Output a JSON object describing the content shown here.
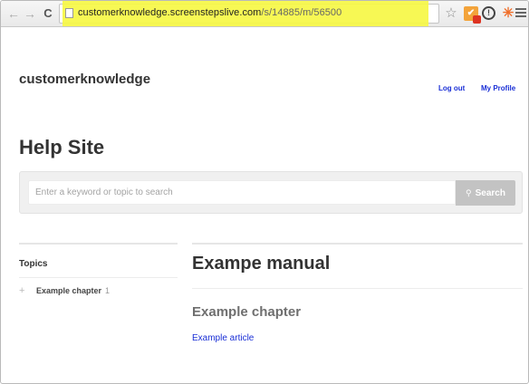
{
  "browser": {
    "url_host": "customerknowledge.screenstepslive.com",
    "url_path": "/s/14885/m/56500",
    "icons": [
      "back-arrow-icon",
      "forward-arrow-icon",
      "reload-icon",
      "page-icon",
      "star-icon",
      "extension-orange-icon",
      "extension-circle-icon",
      "hubspot-icon",
      "menu-icon"
    ],
    "highlight_color": "#f6f745"
  },
  "header": {
    "brand": "customerknowledge",
    "logout_label": "Log out",
    "profile_label": "My Profile",
    "link_color": "#1a2fd6"
  },
  "site": {
    "title": "Help Site"
  },
  "search": {
    "placeholder": "Enter a keyword or topic to search",
    "value": "",
    "button_label": "Search",
    "button_icon": "search-icon"
  },
  "sidebar": {
    "title": "Topics",
    "items": [
      {
        "label": "Example chapter",
        "count": "1",
        "icon": "plus-icon"
      }
    ]
  },
  "main": {
    "manual_title": "Exampe manual",
    "chapter_title": "Example chapter",
    "article_link": "Example article"
  }
}
